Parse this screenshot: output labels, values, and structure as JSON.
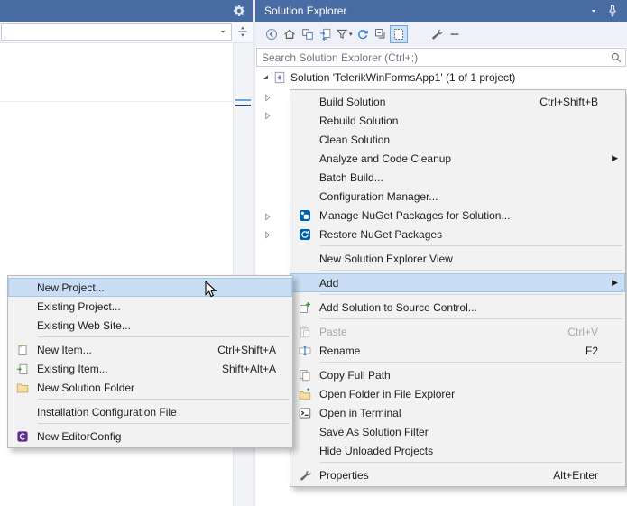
{
  "colors": {
    "titlebar_blue": "#4A6CA4",
    "menu_background": "#F2F2F2",
    "menu_highlight": "#C9DEF5"
  },
  "editor": {
    "navbar_dropdown_value": ""
  },
  "solution_explorer": {
    "title": "Solution Explorer",
    "title_bar_icons": [
      "chevron-down-icon",
      "pin-icon"
    ],
    "search_placeholder": "Search Solution Explorer (Ctrl+;)",
    "tree_root_label": "Solution 'TelerikWinFormsApp1' (1 of 1 project)",
    "toolbar": [
      {
        "icon": "back-icon"
      },
      {
        "icon": "home-icon"
      },
      {
        "icon": "switch-views-icon"
      },
      {
        "icon": "sync-active-document-icon"
      },
      {
        "icon": "filter-icon",
        "chevron": true
      },
      {
        "icon": "refresh-icon"
      },
      {
        "icon": "collapse-all-icon"
      },
      {
        "icon": "show-all-files-icon",
        "pressed": true
      },
      {
        "icon": "properties-wrench-icon",
        "gap_before": true
      },
      {
        "icon": "overflow-dash-icon"
      }
    ]
  },
  "context_menu": {
    "items": [
      {
        "label": "Build Solution",
        "shortcut": "Ctrl+Shift+B"
      },
      {
        "label": "Rebuild Solution"
      },
      {
        "label": "Clean Solution"
      },
      {
        "label": "Analyze and Code Cleanup",
        "submenu": true
      },
      {
        "label": "Batch Build..."
      },
      {
        "label": "Configuration Manager..."
      },
      {
        "label": "Manage NuGet Packages for Solution...",
        "icon": "nuget-icon"
      },
      {
        "label": "Restore NuGet Packages",
        "icon": "nuget-restore-icon"
      },
      {
        "type": "separator"
      },
      {
        "label": "New Solution Explorer View"
      },
      {
        "type": "separator"
      },
      {
        "label": "Add",
        "submenu": true,
        "highlighted": true
      },
      {
        "type": "separator"
      },
      {
        "label": "Add Solution to Source Control...",
        "icon": "source-control-add-icon"
      },
      {
        "type": "separator"
      },
      {
        "label": "Paste",
        "shortcut": "Ctrl+V",
        "disabled": true,
        "icon": "paste-icon"
      },
      {
        "label": "Rename",
        "shortcut": "F2",
        "icon": "rename-icon"
      },
      {
        "type": "separator"
      },
      {
        "label": "Copy Full Path",
        "icon": "copy-path-icon"
      },
      {
        "label": "Open Folder in File Explorer",
        "icon": "open-folder-icon"
      },
      {
        "label": "Open in Terminal",
        "icon": "terminal-icon"
      },
      {
        "label": "Save As Solution Filter"
      },
      {
        "label": "Hide Unloaded Projects"
      },
      {
        "type": "separator"
      },
      {
        "label": "Properties",
        "shortcut": "Alt+Enter",
        "icon": "properties-wrench-icon"
      }
    ]
  },
  "add_submenu": {
    "items": [
      {
        "label": "New Project...",
        "highlighted": true
      },
      {
        "label": "Existing Project..."
      },
      {
        "label": "Existing Web Site..."
      },
      {
        "type": "separator"
      },
      {
        "label": "New Item...",
        "shortcut": "Ctrl+Shift+A",
        "icon": "new-item-icon"
      },
      {
        "label": "Existing Item...",
        "shortcut": "Shift+Alt+A",
        "icon": "existing-item-icon"
      },
      {
        "label": "New Solution Folder",
        "icon": "new-folder-icon"
      },
      {
        "type": "separator"
      },
      {
        "label": "Installation Configuration File"
      },
      {
        "type": "separator"
      },
      {
        "label": "New EditorConfig",
        "icon": "editorconfig-icon"
      }
    ]
  }
}
